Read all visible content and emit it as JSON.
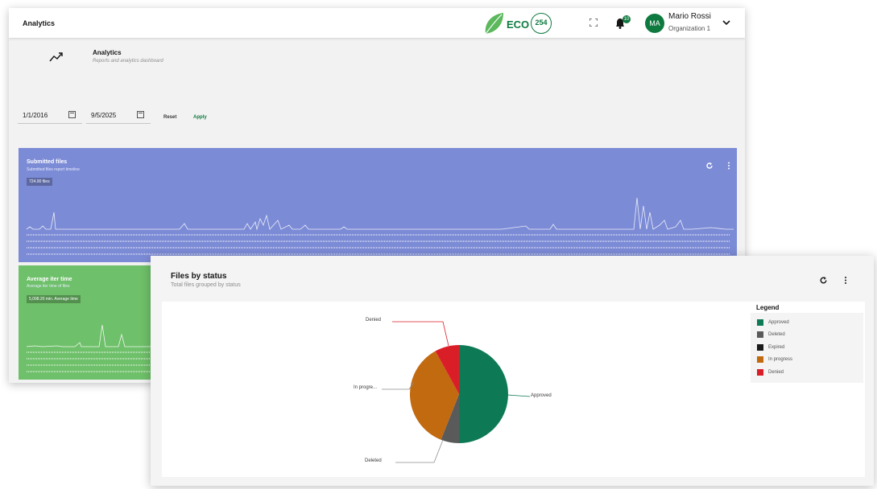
{
  "app": {
    "title": "Analytics"
  },
  "brand": {
    "name": "ECO",
    "badge": "254",
    "color": "#0e7a3f"
  },
  "header": {
    "notifications_count": "10",
    "user": {
      "initials": "MA",
      "name": "Mario Rossi",
      "organization": "Organization 1"
    }
  },
  "page": {
    "title": "Analytics",
    "subtitle": "Reports and analytics dashboard"
  },
  "filters": {
    "start_date": "1/1/2016",
    "end_date": "9/5/2025",
    "reset_label": "Reset",
    "apply_label": "Apply"
  },
  "cards": {
    "submitted": {
      "title": "Submitted files",
      "subtitle": "Submitted files report timeline",
      "tooltip": "724.00 files",
      "color": "#7c8bd6"
    },
    "average": {
      "title": "Average iter time",
      "subtitle": "Average iter time of files",
      "tooltip": "5,098.20 min. Average time",
      "color": "#6fc06a"
    }
  },
  "status_chart": {
    "title": "Files by status",
    "subtitle": "Total files grouped by status",
    "legend_title": "Legend",
    "legend": [
      {
        "label": "Approved",
        "color": "#0e7a55"
      },
      {
        "label": "Deleted",
        "color": "#5a5a5a"
      },
      {
        "label": "Expired",
        "color": "#1a1a1a"
      },
      {
        "label": "In progress",
        "color": "#c26a10"
      },
      {
        "label": "Denied",
        "color": "#da1e28"
      }
    ],
    "labels": {
      "denied": "Denied",
      "in_progress": "In progre...",
      "approved": "Approved",
      "deleted": "Deleted"
    }
  },
  "chart_data": {
    "type": "pie",
    "categories": [
      "Approved",
      "Deleted",
      "Expired",
      "In progress",
      "Denied"
    ],
    "values": [
      50,
      6,
      0,
      36,
      8
    ]
  }
}
